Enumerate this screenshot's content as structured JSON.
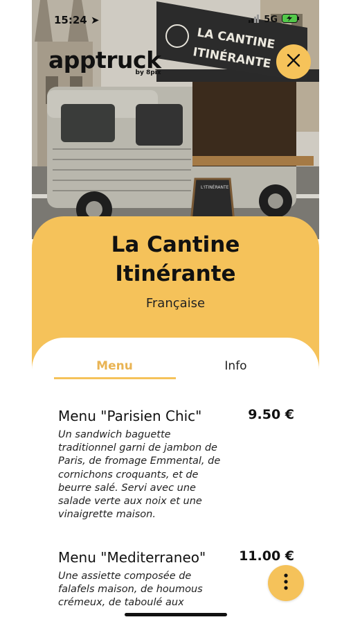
{
  "status_bar": {
    "time": "15:24",
    "network": "5G"
  },
  "brand": {
    "name": "apptruck",
    "by": "by 8pix"
  },
  "truck_sign": {
    "line1": "LA CANTINE",
    "line2": "ITINÉRANTE",
    "board": "L'ITINÉRANTE"
  },
  "restaurant": {
    "title_line1": "La Cantine",
    "title_line2": "Itinérante",
    "cuisine": "Française"
  },
  "tabs": [
    {
      "label": "Menu",
      "active": true
    },
    {
      "label": "Info",
      "active": false
    }
  ],
  "menu_items": [
    {
      "name": "Menu \"Parisien Chic\"",
      "price": "9.50 €",
      "description": "Un sandwich baguette traditionnel garni de jambon de Paris, de fromage Emmental, de cornichons croquants, et de beurre salé. Servi avec une salade verte aux noix et une vinaigrette maison."
    },
    {
      "name": "Menu \"Mediterraneo\"",
      "price": "11.00 €",
      "description": "Une assiette composée de falafels maison, de houmous crémeux, de taboulé aux"
    }
  ],
  "colors": {
    "accent": "#f5c25a",
    "text": "#111111",
    "tab_active": "#e9b454"
  },
  "icons": {
    "close": "close-icon",
    "more": "more-vertical-icon",
    "location": "location-arrow-icon"
  }
}
